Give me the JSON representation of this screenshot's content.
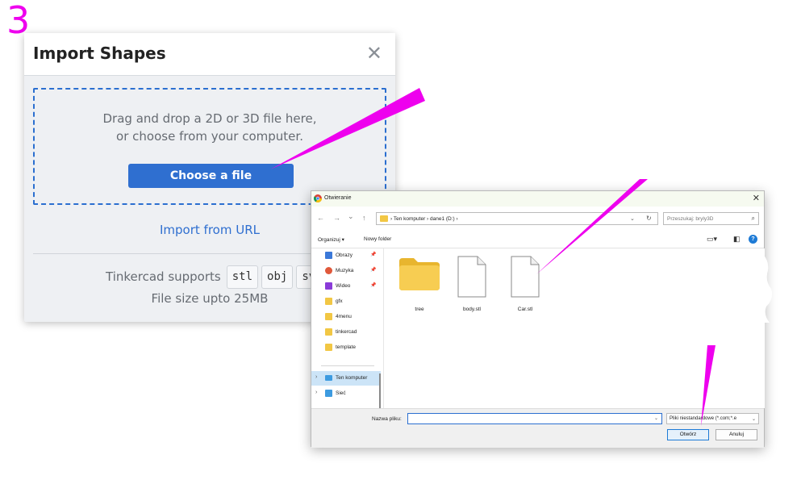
{
  "step_number": "3",
  "import_dialog": {
    "title": "Import Shapes",
    "close_glyph": "✕",
    "drop_line1": "Drag and drop a 2D or 3D file here,",
    "drop_line2": "or choose from your computer.",
    "choose_button": "Choose a file",
    "import_url": "Import from URL",
    "supports_label": "Tinkercad supports",
    "formats": [
      "stl",
      "obj",
      "svg"
    ],
    "file_size": "File size upto 25MB"
  },
  "open_dialog": {
    "title": "Otwieranie",
    "close_glyph": "✕",
    "nav_back": "←",
    "nav_forward": "→",
    "nav_recent": "⌄",
    "nav_up": "↑",
    "path": [
      "Ten komputer",
      "dane1 (D:)"
    ],
    "path_display": "›  Ten komputer  ›  dane1 (D:)  ›",
    "search_placeholder": "Przeszukaj: bryly3D",
    "toolbar": {
      "organize": "Organizuj ▾",
      "new_folder": "Nowy folder"
    },
    "sidebar": {
      "quick_access": [
        {
          "label": "Obrazy",
          "icon": "pictures-icon",
          "color": "#3b78d8",
          "pinned": true
        },
        {
          "label": "Muzyka",
          "icon": "music-icon",
          "color": "#e0593b",
          "pinned": true
        },
        {
          "label": "Wideo",
          "icon": "video-icon",
          "color": "#8a3bd8",
          "pinned": true
        },
        {
          "label": "gfx",
          "icon": "folder-icon",
          "color": "#f2c744",
          "pinned": false
        },
        {
          "label": "4menu",
          "icon": "folder-icon",
          "color": "#f2c744",
          "pinned": false
        },
        {
          "label": "tinkercad",
          "icon": "folder-icon",
          "color": "#f2c744",
          "pinned": false
        },
        {
          "label": "template",
          "icon": "folder-icon",
          "color": "#f2c744",
          "pinned": false
        }
      ],
      "this_pc": "Ten komputer",
      "network": "Sieć"
    },
    "files": [
      {
        "name": "tree",
        "type": "folder"
      },
      {
        "name": "body.stl",
        "type": "file"
      },
      {
        "name": "Car.stl",
        "type": "file"
      }
    ],
    "filename_label": "Nazwa pliku:",
    "filename_value": "",
    "filter": "Pliki niestandardowe (*.com;*.e",
    "open_button": "Otwórz",
    "cancel_button": "Anuluj"
  },
  "colors": {
    "accent_blue": "#2f6fd0",
    "annotation_magenta": "#ee00ee",
    "folder_yellow": "#f2c744"
  }
}
